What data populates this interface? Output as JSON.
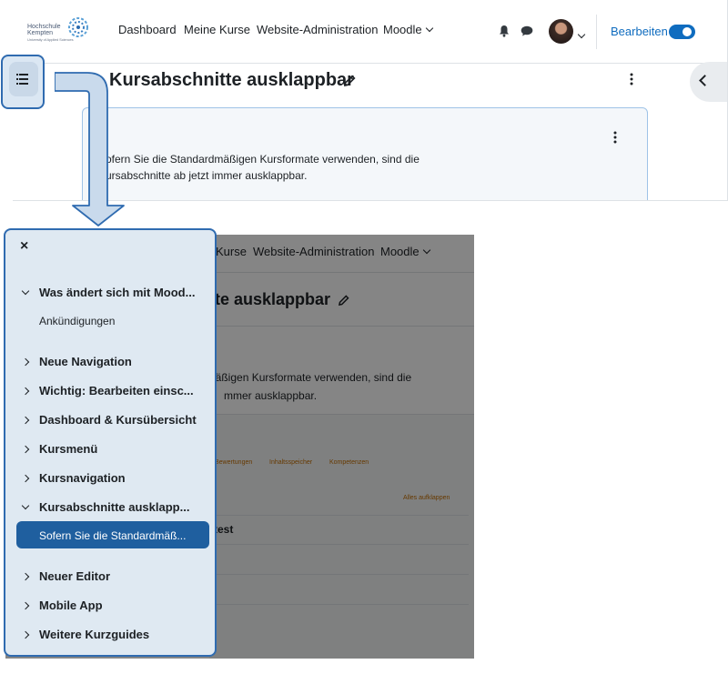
{
  "top": {
    "logo": {
      "line1": "Hochschule",
      "line2": "Kempten",
      "line3": "University of Applied Sciences"
    },
    "nav": [
      "Dashboard",
      "Meine Kurse",
      "Website-Administration",
      "Moodle"
    ],
    "edit_label": "Bearbeiten",
    "title": "Kursabschnitte ausklappbar",
    "card_text_1": "Sofern Sie die Standardmäßigen Kursformate verwenden, sind die",
    "card_text_2": "Kursabschnitte ab jetzt immer ausklappbar."
  },
  "bottom": {
    "nav": [
      "Kurse",
      "Website-Administration",
      "Moodle"
    ],
    "title_partial": "te ausklappbar",
    "text_1": "näßigen Kursformate verwenden, sind die",
    "text_2": "mmer ausklappbar.",
    "tabs": [
      "Bewertungen",
      "Inhaltsspeicher",
      "Kompetenzen"
    ],
    "expand_all": "Alles aufklappen",
    "row_partial": "test"
  },
  "drawer": {
    "close": "×",
    "items": [
      {
        "label": "Was ändert sich mit Mood...",
        "expanded": true
      },
      {
        "label": "Ankündigungen",
        "sub": true
      },
      {
        "label": "Neue Navigation",
        "expanded": false
      },
      {
        "label": "Wichtig: Bearbeiten einsc...",
        "expanded": false
      },
      {
        "label": "Dashboard & Kursübersicht",
        "expanded": false
      },
      {
        "label": "Kursmenü",
        "expanded": false
      },
      {
        "label": "Kursnavigation",
        "expanded": false
      },
      {
        "label": "Kursabschnitte ausklapp...",
        "expanded": true
      },
      {
        "label": "Sofern Sie die Standardmäß...",
        "active": true
      },
      {
        "label": "Neuer Editor",
        "expanded": false
      },
      {
        "label": "Mobile App",
        "expanded": false
      },
      {
        "label": "Weitere Kurzguides",
        "expanded": false
      }
    ]
  },
  "colors": {
    "primary": "#0f6cbf",
    "callout": "#2f6bb0",
    "callout_fill": "#dfe9f2",
    "active": "#1f5f9f"
  }
}
